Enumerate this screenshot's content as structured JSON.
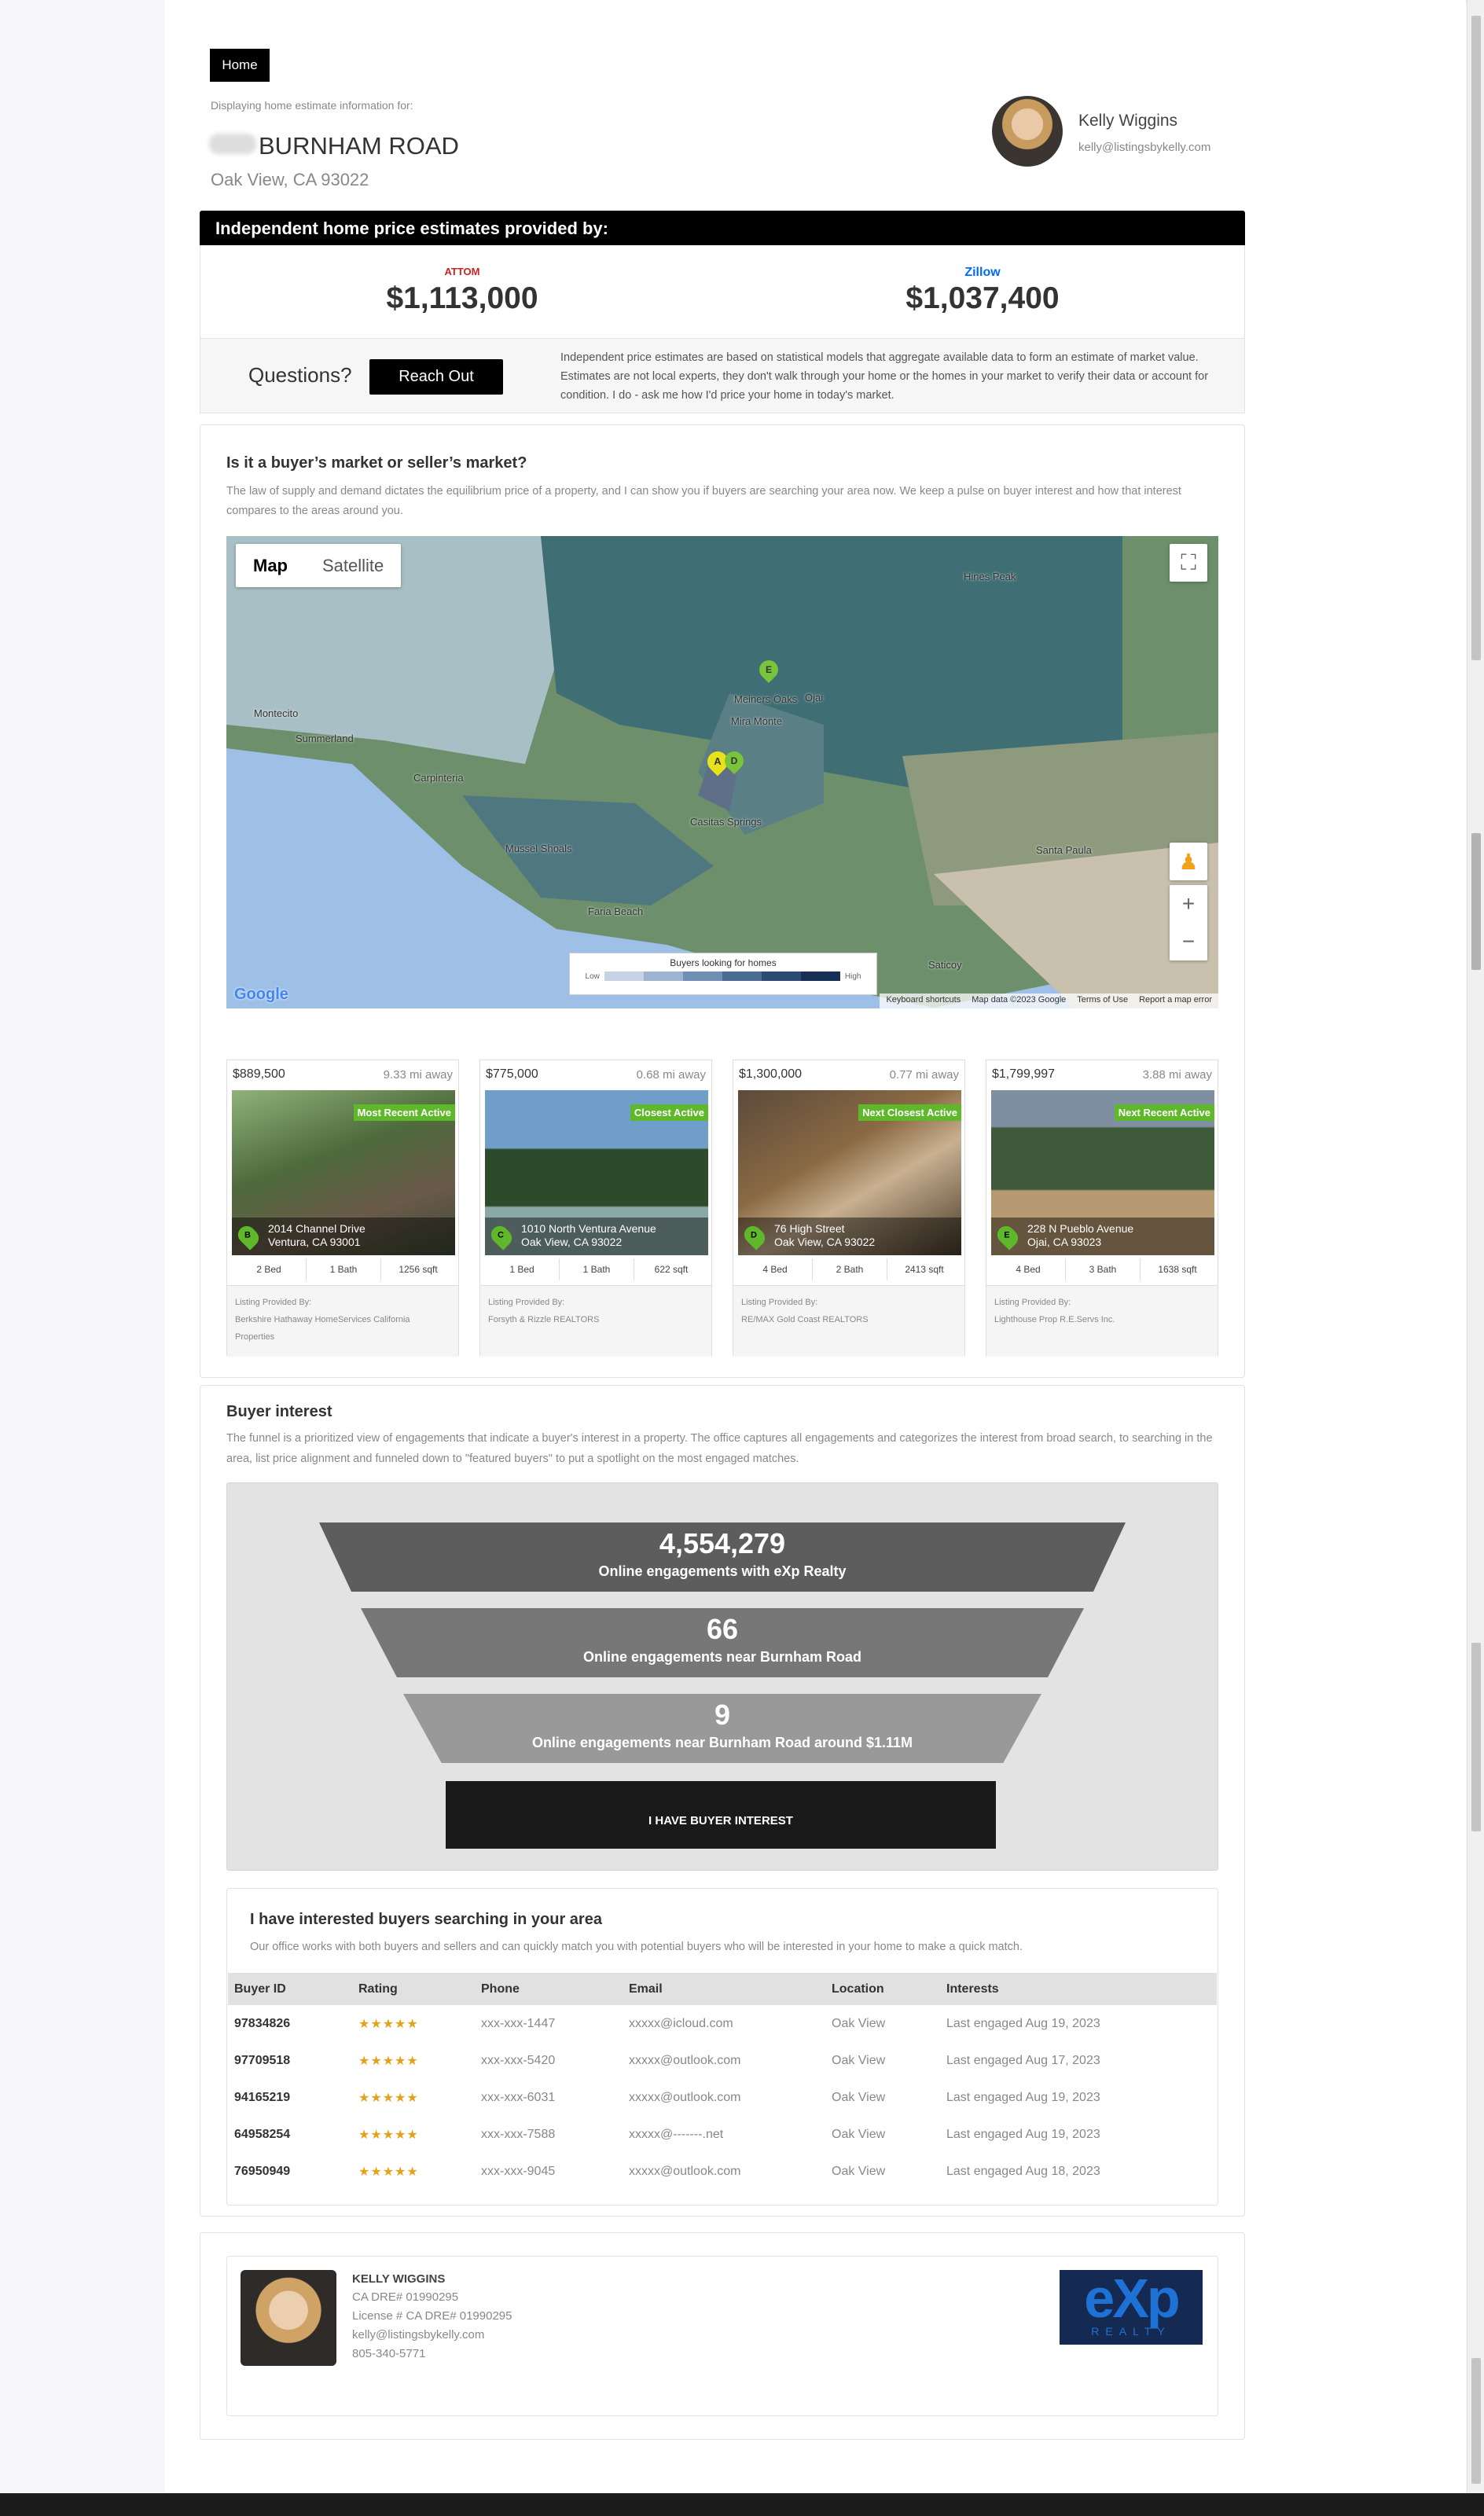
{
  "header": {
    "home_label": "Home",
    "displaying_text": "Displaying home estimate information for:",
    "address_street": "BURNHAM ROAD",
    "address_city": "Oak View, CA 93022"
  },
  "agent": {
    "name": "Kelly Wiggins",
    "email": "kelly@listingsbykelly.com"
  },
  "estimates": {
    "heading": "Independent home price estimates provided by:",
    "providers": [
      {
        "name": "ATTOM",
        "value": "$1,113,000"
      },
      {
        "name": "Zillow",
        "value": "$1,037,400"
      }
    ],
    "questions_label": "Questions?",
    "reach_out_label": "Reach Out",
    "disclaimer": "Independent price estimates are based on statistical models that aggregate available data to form an estimate of market value. Estimates are not local experts, they don't walk through your home or the homes in your market to verify their data or account for condition. I do - ask me how I'd price your home in today's market."
  },
  "market": {
    "heading": "Is it a buyer’s market or seller’s market?",
    "description": "The law of supply and demand dictates the equilibrium price of a property, and I can show you if buyers are searching your area now. We keep a pulse on buyer interest and how that interest compares to the areas around you."
  },
  "map": {
    "map_label": "Map",
    "satellite_label": "Satellite",
    "legend_title": "Buyers looking for homes",
    "legend_low": "Low",
    "legend_high": "High",
    "google_label": "Google",
    "attribution": [
      "Keyboard shortcuts",
      "Map data ©2023 Google",
      "Terms of Use",
      "Report a map error"
    ],
    "places": [
      "Montecito",
      "Summerland",
      "Carpinteria",
      "Meiners Oaks",
      "Ojai",
      "Mira Monte",
      "Casitas Springs",
      "Mussel Shoals",
      "Faria Beach",
      "Santa Paula",
      "Saticoy",
      "Hines Peak"
    ],
    "markers": [
      "A",
      "D",
      "E"
    ],
    "colors": {
      "legend": [
        "#c6d3e4",
        "#9db3cf",
        "#6f8eb3",
        "#4a6b94",
        "#2c4a73",
        "#172f55"
      ]
    }
  },
  "listings": [
    {
      "price": "$889,500",
      "distance": "9.33 mi away",
      "badge": "Most Recent Active",
      "marker": "B",
      "street": "2014 Channel Drive",
      "city": "Ventura, CA 93001",
      "beds": "2 Bed",
      "baths": "1 Bath",
      "sqft": "1256 sqft",
      "provided_label": "Listing Provided By:",
      "provider": "Berkshire Hathaway HomeServices California Properties"
    },
    {
      "price": "$775,000",
      "distance": "0.68 mi away",
      "badge": "Closest Active",
      "marker": "C",
      "street": "1010 North Ventura Avenue",
      "city": "Oak View, CA 93022",
      "beds": "1 Bed",
      "baths": "1 Bath",
      "sqft": "622 sqft",
      "provided_label": "Listing Provided By:",
      "provider": "Forsyth & Rizzle REALTORS"
    },
    {
      "price": "$1,300,000",
      "distance": "0.77 mi away",
      "badge": "Next Closest Active",
      "marker": "D",
      "street": "76 High Street",
      "city": "Oak View, CA 93022",
      "beds": "4 Bed",
      "baths": "2 Bath",
      "sqft": "2413 sqft",
      "provided_label": "Listing Provided By:",
      "provider": "RE/MAX Gold Coast REALTORS"
    },
    {
      "price": "$1,799,997",
      "distance": "3.88 mi away",
      "badge": "Next Recent Active",
      "marker": "E",
      "street": "228 N Pueblo Avenue",
      "city": "Ojai, CA 93023",
      "beds": "4 Bed",
      "baths": "3 Bath",
      "sqft": "1638 sqft",
      "provided_label": "Listing Provided By:",
      "provider": "Lighthouse Prop R.E.Servs Inc."
    }
  ],
  "buyer_interest": {
    "heading": "Buyer interest",
    "description": "The funnel is a prioritized view of engagements that indicate a buyer's interest in a property. The office captures all engagements and categorizes the interest from broad search, to searching in the area, list price alignment and funneled down to \"featured buyers\" to put a spotlight on the most engaged matches.",
    "tiers": [
      {
        "value": "4,554,279",
        "label": "Online engagements with eXp Realty"
      },
      {
        "value": "66",
        "label": "Online engagements near Burnham Road"
      },
      {
        "value": "9",
        "label": "Online engagements near Burnham Road around $1.11M"
      }
    ],
    "button_label": "I HAVE BUYER INTEREST"
  },
  "buyers_section": {
    "heading": "I have interested buyers searching in your area",
    "description": "Our office works with both buyers and sellers and can quickly match you with potential buyers who will be interested in your home to make a quick match.",
    "columns": [
      "Buyer ID",
      "Rating",
      "Phone",
      "Email",
      "Location",
      "Interests"
    ],
    "rows": [
      {
        "id": "97834826",
        "rating": "★★★★★",
        "phone": "xxx-xxx-1447",
        "email": "xxxxx@icloud.com",
        "location": "Oak View",
        "interest": "Last engaged Aug 19, 2023"
      },
      {
        "id": "97709518",
        "rating": "★★★★★",
        "phone": "xxx-xxx-5420",
        "email": "xxxxx@outlook.com",
        "location": "Oak View",
        "interest": "Last engaged Aug 17, 2023"
      },
      {
        "id": "94165219",
        "rating": "★★★★★",
        "phone": "xxx-xxx-6031",
        "email": "xxxxx@outlook.com",
        "location": "Oak View",
        "interest": "Last engaged Aug 19, 2023"
      },
      {
        "id": "64958254",
        "rating": "★★★★★",
        "phone": "xxx-xxx-7588",
        "email": "xxxxx@-------.net",
        "location": "Oak View",
        "interest": "Last engaged Aug 19, 2023"
      },
      {
        "id": "76950949",
        "rating": "★★★★★",
        "phone": "xxx-xxx-9045",
        "email": "xxxxx@outlook.com",
        "location": "Oak View",
        "interest": "Last engaged Aug 18, 2023"
      }
    ]
  },
  "footer_agent": {
    "name": "KELLY WIGGINS",
    "dre": "CA DRE# 01990295",
    "license": "License # CA DRE# 01990295",
    "email": "kelly@listingsbykelly.com",
    "phone": "805-340-5771",
    "logo_text": "eXp",
    "logo_sub": "REALTY"
  }
}
